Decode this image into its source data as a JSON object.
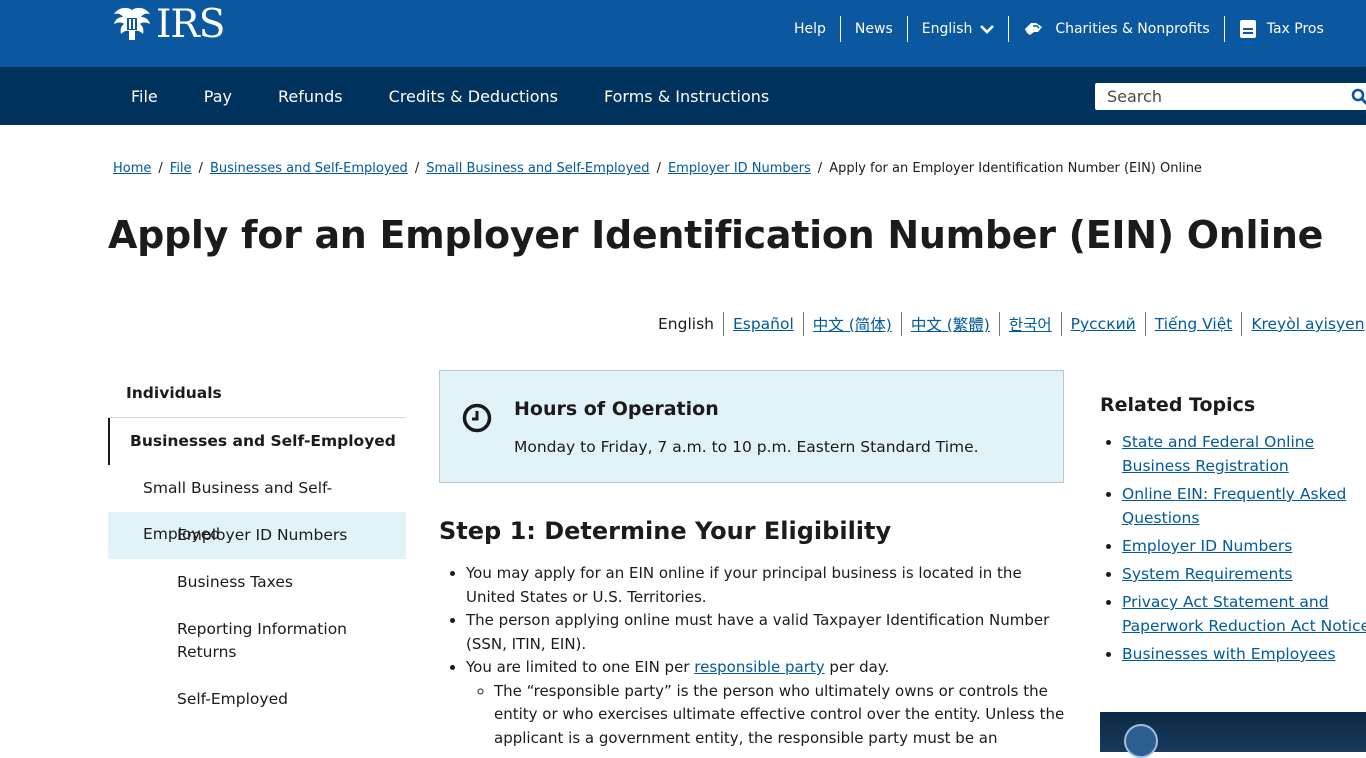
{
  "header": {
    "logo_text": "IRS",
    "utility": {
      "help": "Help",
      "news": "News",
      "language": "English",
      "charities": "Charities & Nonprofits",
      "tax_pros": "Tax Pros"
    }
  },
  "nav": {
    "items": [
      "File",
      "Pay",
      "Refunds",
      "Credits & Deductions",
      "Forms & Instructions"
    ],
    "search_placeholder": "Search"
  },
  "breadcrumb": {
    "items": [
      "Home",
      "File",
      "Businesses and Self-Employed",
      "Small Business and Self-Employed",
      "Employer ID Numbers"
    ],
    "current": "Apply for an Employer Identification Number (EIN) Online"
  },
  "page": {
    "title": "Apply for an Employer Identification Number (EIN) Online"
  },
  "languages": {
    "current": "English",
    "links": [
      "Español",
      "中文 (简体)",
      "中文 (繁體)",
      "한국어",
      "Русский",
      "Tiếng Việt",
      "Kreyòl ayisyen"
    ]
  },
  "sidebar": {
    "items": [
      "Individuals",
      "Businesses and Self-Employed",
      "Small Business and Self-Employed",
      "Employer ID Numbers",
      "Business Taxes",
      "Reporting Information Returns",
      "Self-Employed"
    ]
  },
  "hours": {
    "title": "Hours of Operation",
    "text": "Monday to Friday, 7 a.m. to 10 p.m. Eastern Standard Time."
  },
  "step1": {
    "title": "Step 1: Determine Your Eligibility",
    "bullet1": "You may apply for an EIN online if your principal business is located in the United States or U.S. Territories.",
    "bullet2": "The person applying online must have a valid Taxpayer Identification Number (SSN, ITIN, EIN).",
    "bullet3_pre": "You are limited to one EIN per ",
    "bullet3_link": "responsible party",
    "bullet3_post": " per day.",
    "sub1": "The “responsible party” is the person who ultimately owns or controls the entity or who exercises ultimate effective control over the entity. Unless the applicant is a government entity, the responsible party must be an"
  },
  "related": {
    "title": "Related Topics",
    "links": [
      "State and Federal Online Business Registration",
      "Online EIN: Frequently Asked Questions",
      "Employer ID Numbers",
      "System Requirements",
      "Privacy Act Statement and Paperwork Reduction Act Notice",
      "Businesses with Employees"
    ]
  },
  "colors": {
    "top_bar": "#0b58a1",
    "main_nav": "#00325e",
    "link": "#00599c",
    "highlight": "#e1f3f8"
  }
}
